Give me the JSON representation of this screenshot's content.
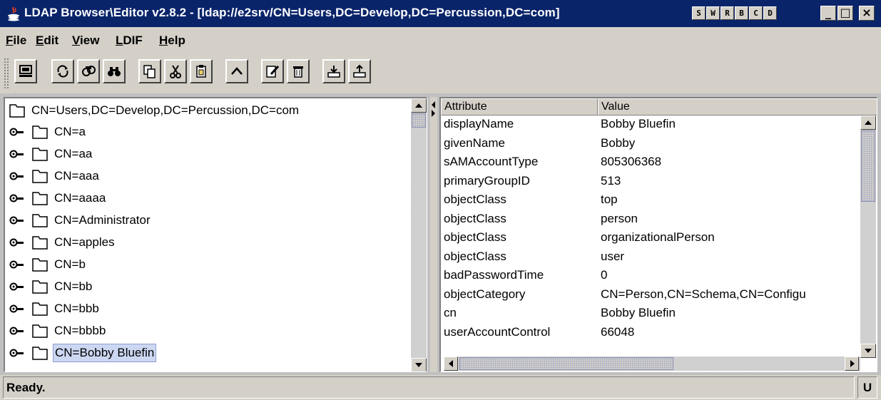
{
  "window": {
    "title": "LDAP Browser\\Editor v2.8.2 - [ldap://e2srv/CN=Users,DC=Develop,DC=Percussion,DC=com]",
    "sys_buttons": [
      "S",
      "W",
      "R",
      "B",
      "C",
      "D"
    ],
    "controls": {
      "minimize": "_",
      "maximize": "□",
      "close": "×"
    },
    "title_bg": "#0a246a"
  },
  "menu": [
    {
      "mn": "F",
      "rest": "ile"
    },
    {
      "mn": "E",
      "rest": "dit"
    },
    {
      "mn": "V",
      "rest": "iew"
    },
    {
      "mn": "L",
      "rest": "DIF"
    },
    {
      "mn": "H",
      "rest": "elp"
    }
  ],
  "toolbar": {
    "icons": [
      "connect-icon",
      "refresh-icon",
      "search-icon",
      "find-icon",
      "copy-icon",
      "cut-icon",
      "paste-icon",
      "up-icon",
      "edit-icon",
      "delete-icon",
      "export-icon",
      "import-icon"
    ]
  },
  "tree": {
    "root": "CN=Users,DC=Develop,DC=Percussion,DC=com",
    "items": [
      {
        "label": "CN=a"
      },
      {
        "label": "CN=aa"
      },
      {
        "label": "CN=aaa"
      },
      {
        "label": "CN=aaaa"
      },
      {
        "label": "CN=Administrator"
      },
      {
        "label": "CN=apples"
      },
      {
        "label": "CN=b"
      },
      {
        "label": "CN=bb"
      },
      {
        "label": "CN=bbb"
      },
      {
        "label": "CN=bbbb"
      },
      {
        "label": "CN=Bobby Bluefin",
        "selected": true
      }
    ],
    "selection_color": "#ccd7f2"
  },
  "attributes": {
    "columns": [
      "Attribute",
      "Value"
    ],
    "rows": [
      {
        "attribute": "displayName",
        "value": "Bobby Bluefin"
      },
      {
        "attribute": "givenName",
        "value": "Bobby"
      },
      {
        "attribute": "sAMAccountType",
        "value": "805306368"
      },
      {
        "attribute": "primaryGroupID",
        "value": "513"
      },
      {
        "attribute": "objectClass",
        "value": "top"
      },
      {
        "attribute": "objectClass",
        "value": "person"
      },
      {
        "attribute": "objectClass",
        "value": "organizationalPerson"
      },
      {
        "attribute": "objectClass",
        "value": "user"
      },
      {
        "attribute": "badPasswordTime",
        "value": "0"
      },
      {
        "attribute": "objectCategory",
        "value": "CN=Person,CN=Schema,CN=Configu"
      },
      {
        "attribute": "cn",
        "value": "Bobby Bluefin"
      },
      {
        "attribute": "userAccountControl",
        "value": "66048"
      }
    ]
  },
  "status": {
    "text": "Ready.",
    "mode": "U"
  }
}
